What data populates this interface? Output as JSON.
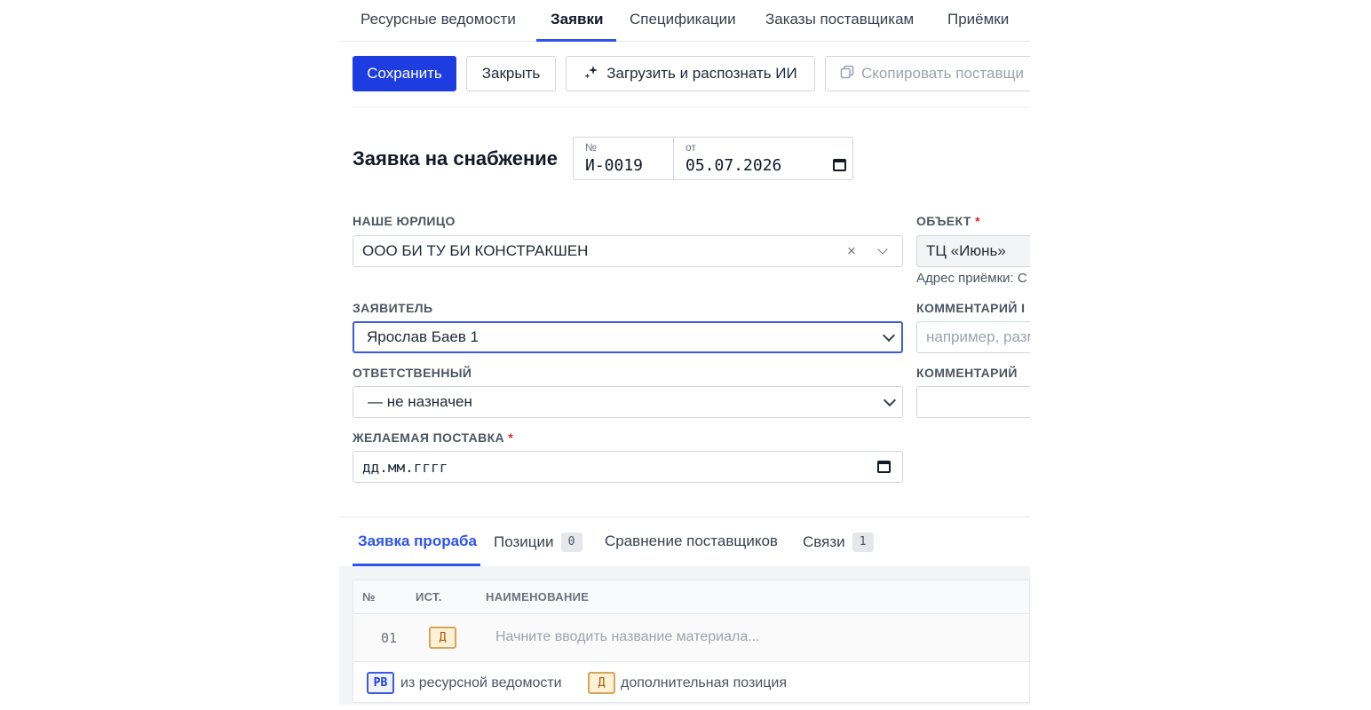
{
  "nav": {
    "tabs": [
      {
        "label": "Ресурсные ведомости"
      },
      {
        "label": "Заявки"
      },
      {
        "label": "Спецификации"
      },
      {
        "label": "Заказы поставщикам"
      },
      {
        "label": "Приёмки"
      }
    ],
    "active_tab": "Заявки"
  },
  "toolbar": {
    "save_label": "Сохранить",
    "close_label": "Закрыть",
    "upload_ai_label": "Загрузить и распознать ИИ",
    "copy_label": "Скопировать поставщи"
  },
  "header": {
    "title": "Заявка на снабжение",
    "number_label": "№",
    "number_value": "И-0019",
    "date_label": "от",
    "date_value": "05.07.2026"
  },
  "form": {
    "legal_entity": {
      "label": "НАШЕ ЮРЛИЦО",
      "value": "ООО БИ ТУ БИ КОНСТРАКШЕН",
      "clear": "×"
    },
    "object": {
      "label": "ОБЪЕКТ",
      "required_mark": "*",
      "value": "ТЦ «Июнь»",
      "address_hint": "Адрес приёмки: С"
    },
    "applicant": {
      "label": "ЗАЯВИТЕЛЬ",
      "value": "Ярослав Баев 1"
    },
    "comment1": {
      "label": "КОММЕНТАРИЙ I",
      "placeholder": "например, разм"
    },
    "responsible": {
      "label": "ОТВЕТСТВЕННЫЙ",
      "value": "— не назначен"
    },
    "comment2": {
      "label": "КОММЕНТАРИЙ",
      "value": ""
    },
    "desired_delivery": {
      "label": "ЖЕЛАЕМАЯ ПОСТАВКА",
      "required_mark": "*",
      "placeholder": "дд.мм.гггг"
    }
  },
  "detail_tabs": {
    "tabs": [
      {
        "label": "Заявка прораба"
      },
      {
        "label": "Позиции",
        "count": "0"
      },
      {
        "label": "Сравнение поставщиков"
      },
      {
        "label": "Связи",
        "count": "1"
      }
    ],
    "active_tab": "Заявка прораба"
  },
  "table": {
    "columns": [
      "№",
      "ИСТ.",
      "НАИМЕНОВАНИЕ"
    ],
    "rows": [
      {
        "num": "01",
        "source": "Д",
        "name_placeholder": "Начните вводить название материала..."
      }
    ]
  },
  "legend": {
    "rv_badge": "РВ",
    "rv_text": "из ресурсной ведомости",
    "d_badge": "Д",
    "d_text": "дополнительная позиция"
  },
  "colors": {
    "primary": "#1d3de0",
    "accent_tab": "#2f54eb",
    "required": "#dc2626",
    "badge_d_bg": "#fdf2d6",
    "badge_d_border": "#d9a35b",
    "badge_rv_border": "#3b5bdb"
  },
  "icons": {
    "upload_ai": "sparkle-icon",
    "copy": "copy-icon",
    "date": "calendar-icon",
    "dropdown": "chevron-down-icon",
    "clear": "clear-icon"
  }
}
